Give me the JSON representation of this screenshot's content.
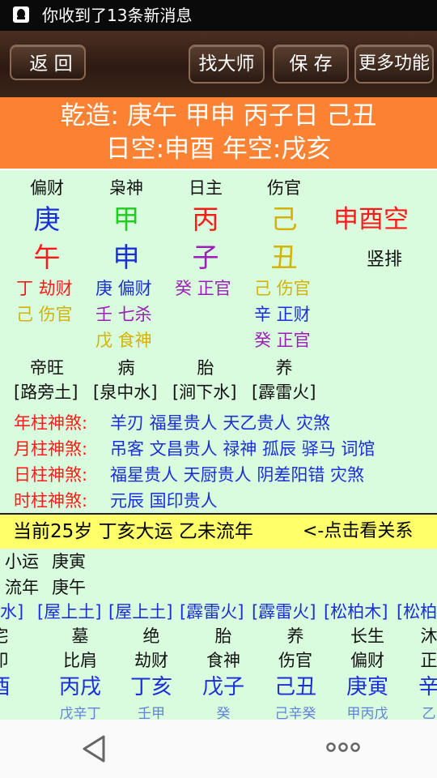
{
  "status_bar": {
    "notification": "你收到了13条新消息"
  },
  "toolbar": {
    "back": "返 回",
    "find_master": "找大师",
    "save": "保 存",
    "more": "更多功能"
  },
  "header": {
    "line1": "乾造: 庚午 甲申 丙子日 己丑",
    "line2": "日空:申酉 年空:戌亥"
  },
  "pillars": {
    "shishen": [
      "偏财",
      "枭神",
      "日主",
      "伤官"
    ],
    "tiangan": [
      {
        "char": "庚",
        "color": "#1a2fd6"
      },
      {
        "char": "甲",
        "color": "#22cc22"
      },
      {
        "char": "丙",
        "color": "#ff1a1a"
      },
      {
        "char": "己",
        "color": "#d4b200"
      }
    ],
    "kong": "申酉空",
    "dizhi": [
      {
        "char": "午",
        "color": "#ff1a1a"
      },
      {
        "char": "申",
        "color": "#1a2fd6"
      },
      {
        "char": "子",
        "color": "#9b1fb5"
      },
      {
        "char": "丑",
        "color": "#d4b200"
      }
    ],
    "vertical": "竖排",
    "canggan": [
      [
        {
          "t": "丁 劫财",
          "color": "#ff1a1a"
        },
        {
          "t": "己 伤官",
          "color": "#d4b200"
        }
      ],
      [
        {
          "t": "庚 偏财",
          "color": "#1a2fd6"
        },
        {
          "t": "壬 七杀",
          "color": "#9b1fb5"
        },
        {
          "t": "戊 食神",
          "color": "#d4b200"
        }
      ],
      [
        {
          "t": "癸 正官",
          "color": "#9b1fb5"
        }
      ],
      [
        {
          "t": "己 伤官",
          "color": "#d4b200"
        },
        {
          "t": "辛 正财",
          "color": "#1a2fd6"
        },
        {
          "t": "癸 正官",
          "color": "#9b1fb5"
        }
      ]
    ],
    "zhangsheng": [
      "帝旺",
      "病",
      "胎",
      "养"
    ],
    "nayin": [
      "[路旁土]",
      "[泉中水]",
      "[涧下水]",
      "[霹雷火]"
    ]
  },
  "shensha": [
    {
      "label": "年柱神煞:",
      "value": "羊刃 福星贵人 天乙贵人 灾煞"
    },
    {
      "label": "月柱神煞:",
      "value": "吊客 文昌贵人 禄神 孤辰 驿马 词馆"
    },
    {
      "label": "日柱神煞:",
      "value": "福星贵人 天厨贵人 阴差阳错 灾煞"
    },
    {
      "label": "时柱神煞:",
      "value": "元辰 国印贵人"
    }
  ],
  "dayun_bar": {
    "text": "当前25岁 丁亥大运 乙未流年",
    "link": "<-点击看关系"
  },
  "xiaoyun": {
    "label": "小运",
    "value": "庚寅"
  },
  "liunian": {
    "label": "流年",
    "value": "庚午"
  },
  "dayun_table": {
    "nayin": [
      "水]",
      "[屋上土]",
      "[屋上土]",
      "[霹雷火]",
      "[霹雷火]",
      "[松柏木]",
      "[松柏"
    ],
    "zhangsheng": [
      "宅",
      "墓",
      "绝",
      "胎",
      "养",
      "长生",
      "沐"
    ],
    "shishen": [
      "印",
      "比肩",
      "劫财",
      "食神",
      "伤官",
      "偏财",
      "正"
    ],
    "ganzhi": [
      "酉",
      "丙戌",
      "丁亥",
      "戊子",
      "己丑",
      "庚寅",
      "辛"
    ],
    "canggan": [
      "",
      "戊辛丁",
      "壬甲",
      "癸",
      "己辛癸",
      "甲丙戊",
      "乙"
    ]
  },
  "colors": {
    "accent": "#fb8133",
    "background": "#d9fbde",
    "highlight": "#ffff6a"
  }
}
